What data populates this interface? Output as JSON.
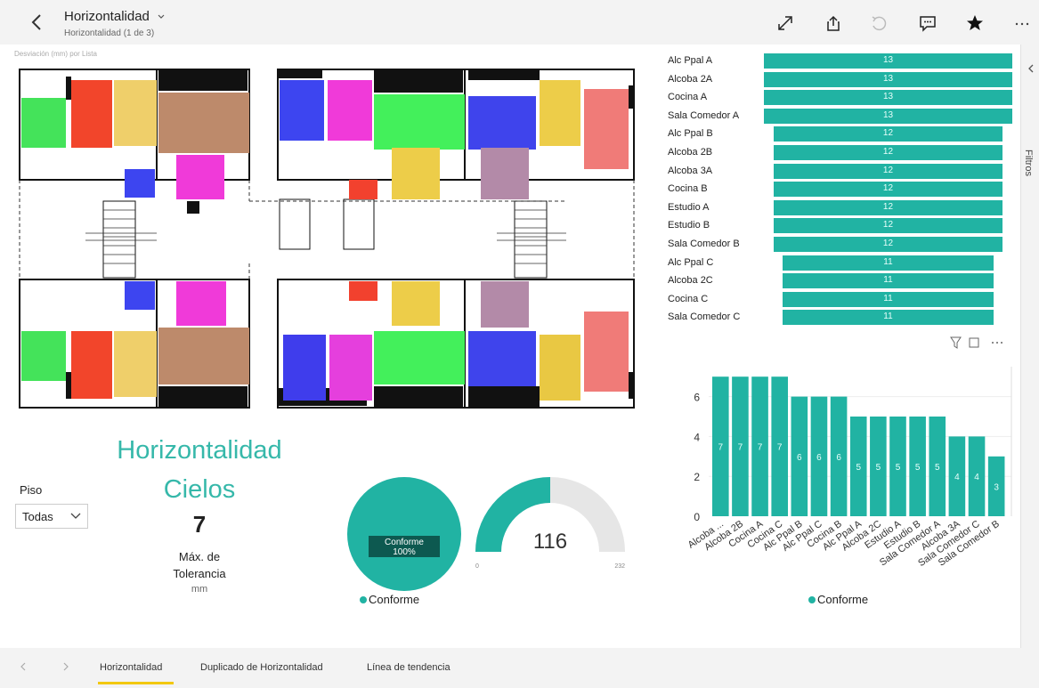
{
  "header": {
    "title": "Horizontalidad",
    "subtitle": "Horizontalidad (1 de 3)"
  },
  "icons": [
    "back-chevron-icon",
    "chevron-down-icon",
    "expand-icon",
    "share-icon",
    "undo-icon",
    "comment-icon",
    "star-icon",
    "more-icon",
    "filter-icon",
    "focus-icon",
    "chevron-left-icon"
  ],
  "filters_pane": {
    "label": "Filtros"
  },
  "floorplan": {
    "title": "Desviación (mm) por Lista",
    "room_colors": [
      "#44e35a",
      "#f2452b",
      "#efcf6a",
      "#bd8a6b",
      "#3d45f0",
      "#f03ad9",
      "#f2412e",
      "#3f3dec",
      "#e53fdd",
      "#43f05b",
      "#3f44ec",
      "#edcd49",
      "#b38aa8",
      "#f07b78",
      "#e9c843"
    ]
  },
  "hbar_chart": {
    "categories": [
      "Alc Ppal A",
      "Alcoba 2A",
      "Cocina A",
      "Sala Comedor A",
      "Alc Ppal B",
      "Alcoba 2B",
      "Alcoba 3A",
      "Cocina B",
      "Estudio A",
      "Estudio B",
      "Sala Comedor B",
      "Alc Ppal C",
      "Alcoba 2C",
      "Cocina C",
      "Sala Comedor C"
    ],
    "values": [
      "13",
      "13",
      "13",
      "13",
      "12",
      "12",
      "12",
      "12",
      "12",
      "12",
      "12",
      "11",
      "11",
      "11",
      "11"
    ],
    "color": "#21b3a3"
  },
  "kpi": {
    "title_line1": "Horizontalidad",
    "title_line2": "Cielos",
    "value": "7",
    "label_line1": "Máx. de",
    "label_line2": "Tolerancia",
    "unit": "mm",
    "color": "#36b8aa"
  },
  "slicer": {
    "label": "Piso",
    "value": "Todas"
  },
  "pie": {
    "label_line1": "Conforme",
    "label_line2": "100%",
    "legend": "Conforme",
    "percent": 100
  },
  "gauge": {
    "value": "116",
    "min": "0",
    "max": "232"
  },
  "chart_data": {
    "type": "bar",
    "categories": [
      "Alcoba ...",
      "Alcoba 2B",
      "Cocina A",
      "Cocina C",
      "Alc Ppal B",
      "Alc Ppal C",
      "Cocina B",
      "Alc Ppal A",
      "Alcoba 2C",
      "Estudio A",
      "Estudio B",
      "Sala Comedor A",
      "Alcoba 3A",
      "Sala Comedor C",
      "Sala Comedor B"
    ],
    "values": [
      7,
      7,
      7,
      7,
      6,
      6,
      6,
      5,
      5,
      5,
      5,
      5,
      4,
      4,
      3
    ],
    "yticks": [
      "0",
      "2",
      "4",
      "6"
    ],
    "ylim": [
      0,
      7.5
    ],
    "legend": "Conforme",
    "color": "#21b3a3"
  },
  "tabs": {
    "labels": [
      "Horizontalidad",
      "Duplicado de Horizontalidad",
      "Línea de tendencia"
    ],
    "active": 0
  }
}
